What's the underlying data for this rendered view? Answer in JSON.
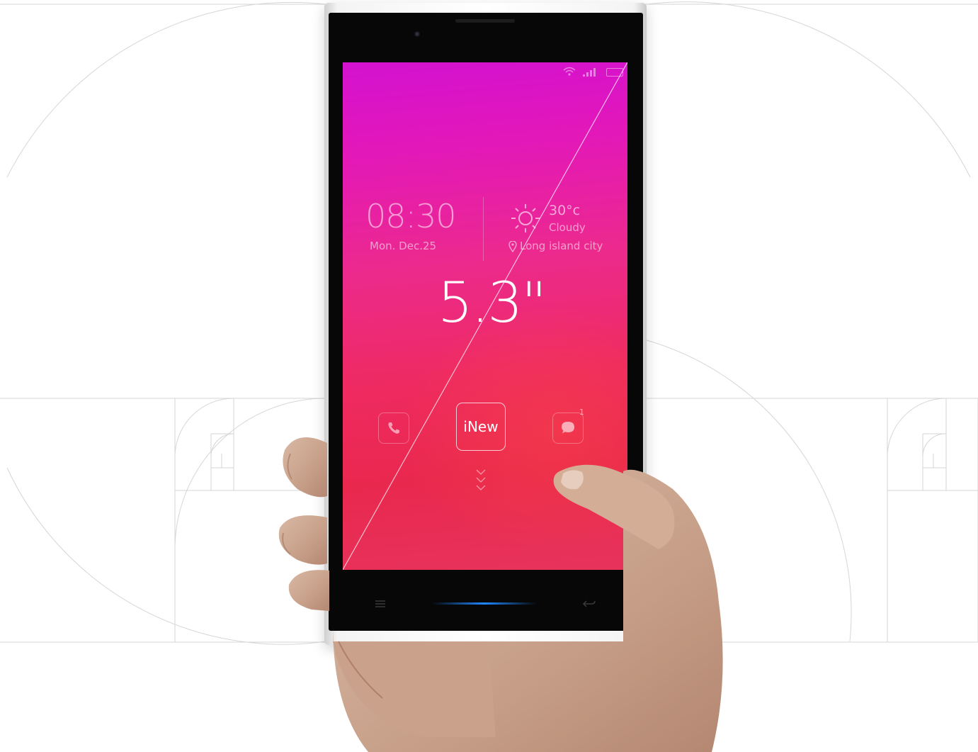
{
  "screen": {
    "clock": "08:30",
    "date": "Mon. Dec.25",
    "temperature": "30°c",
    "weather": "Cloudy",
    "location": "Long island city",
    "size_label": "5.3\"",
    "center_button": "iNew",
    "message_badge": "1"
  },
  "icons": [
    "wifi-icon",
    "signal-icon",
    "battery-icon",
    "sun-icon",
    "location-pin-icon",
    "phone-icon",
    "message-icon",
    "chevron-down-icon",
    "menu-icon",
    "back-icon"
  ],
  "colors": {
    "screen_top": "#d412d0",
    "screen_bottom": "#e9284e",
    "nav_glow": "#1e88ff"
  }
}
